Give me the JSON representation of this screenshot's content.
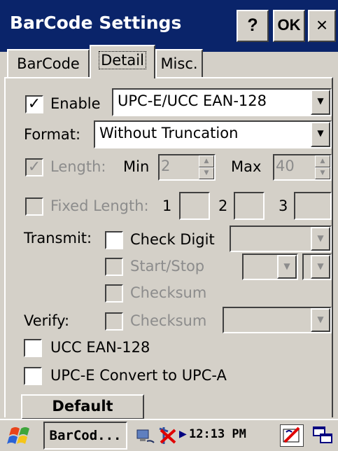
{
  "window": {
    "title": "BarCode Settings",
    "help_label": "?",
    "ok_label": "OK",
    "close_label": "×"
  },
  "tabs": [
    {
      "label": "BarCode",
      "active": false
    },
    {
      "label": "Detail",
      "active": true
    },
    {
      "label": "Misc.",
      "active": false
    }
  ],
  "enable": {
    "label": "Enable",
    "checked": true,
    "symbology": "UPC-E/UCC EAN-128"
  },
  "format": {
    "label": "Format:",
    "value": "Without Truncation"
  },
  "length": {
    "label": "Length:",
    "checked": true,
    "min_label": "Min",
    "min_value": "2",
    "max_label": "Max",
    "max_value": "40"
  },
  "fixed_length": {
    "label": "Fixed Length:",
    "field1_label": "1",
    "field2_label": "2",
    "field3_label": "3"
  },
  "transmit": {
    "label": "Transmit:",
    "check_digit_label": "Check Digit",
    "start_stop_label": "Start/Stop",
    "checksum_label": "Checksum"
  },
  "verify": {
    "label": "Verify:",
    "checksum_label": "Checksum"
  },
  "options": {
    "ucc_ean128_label": "UCC EAN-128",
    "upce_convert_label": "UPC-E Convert to UPC-A"
  },
  "default_button_label": "Default",
  "taskbar": {
    "app_label": "BarCod...",
    "clock": "12:13 PM"
  },
  "colors": {
    "titlebar": "#0a246a",
    "face": "#d4d0c8",
    "disabled_text": "#8c8c8c"
  }
}
